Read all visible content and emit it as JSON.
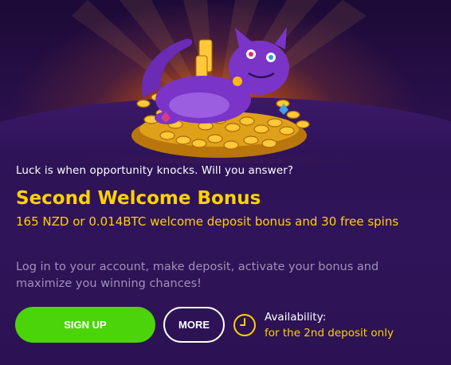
{
  "promo": {
    "tagline": "Luck is when opportunity knocks. Will you answer?",
    "title": "Second Welcome Bonus",
    "subtitle": "165 NZD or 0.014BTC welcome deposit bonus and 30 free spins",
    "description": "Log in to your account, make deposit, activate your bonus and maximize you winning chances!",
    "hero_image": "purple-cat-on-gold-coins"
  },
  "actions": {
    "signup_label": "SIGN UP",
    "more_label": "MORE"
  },
  "availability": {
    "icon": "clock-icon",
    "label": "Availability:",
    "value": "for the 2nd deposit only"
  },
  "colors": {
    "background": "#2a1148",
    "accent_yellow": "#ffd200",
    "signup_green": "#4cd40b",
    "muted_text": "#9e92b6"
  }
}
